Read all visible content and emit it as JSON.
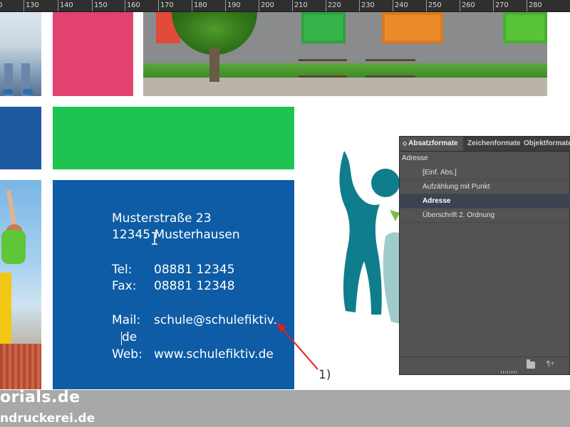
{
  "ruler": {
    "ticks": [
      "130",
      "140",
      "150",
      "160",
      "170",
      "180",
      "190",
      "200",
      "210",
      "220",
      "230",
      "240",
      "250",
      "260",
      "270",
      "280"
    ],
    "partial_start": "0"
  },
  "address": {
    "street": "Musterstraße 23",
    "city": "12345 Musterhausen",
    "tel_label": "Tel:",
    "tel_value": "08881 12345",
    "fax_label": "Fax:",
    "fax_value": "08881 12348",
    "mail_label": "Mail:",
    "mail_value": "schule@schulefiktiv.",
    "mail_wrap": "de",
    "web_label": "Web:",
    "web_value": "www.schulefiktiv.de"
  },
  "annotation": {
    "label": "1)",
    "color": "#e02020"
  },
  "panel": {
    "tabs": [
      "Absatzformate",
      "Zeichenformate",
      "Objektformate"
    ],
    "active_tab": "Absatzformate",
    "current_style": "Adresse",
    "styles": [
      "[Einf. Abs.]",
      "Aufzählung mit Punkt",
      "Adresse",
      "Überschrift 2. Ordnung"
    ],
    "selected_style": "Adresse",
    "footer_para_symbol": "¶+"
  },
  "watermark": {
    "line1": "orials.de",
    "line2": "ndruckerei.de"
  },
  "colors": {
    "address_panel": "#0e5ca5",
    "green_block": "#1dc44f",
    "pink_block": "#e1426f",
    "logo_teal": "#0f7d8c",
    "panel_bg": "#535353"
  },
  "icons": {
    "folder": "folder-icon",
    "paragraph": "paragraph-icon",
    "cursor": "ibeam-cursor-icon"
  }
}
